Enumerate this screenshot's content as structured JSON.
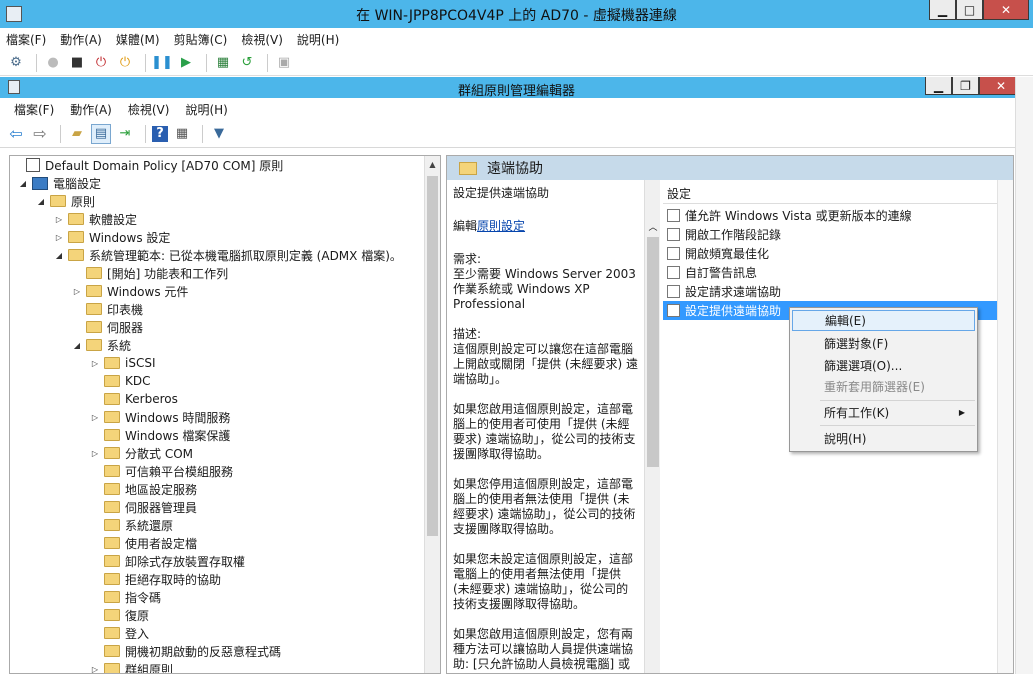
{
  "vm": {
    "title": "在 WIN-JPP8PCO4V4P 上的 AD70 - 虛擬機器連線",
    "menu": [
      "檔案(F)",
      "動作(A)",
      "媒體(M)",
      "剪貼簿(C)",
      "檢視(V)",
      "說明(H)"
    ]
  },
  "gp": {
    "title": "群組原則管理編輯器",
    "menu": [
      "檔案(F)",
      "動作(A)",
      "檢視(V)",
      "說明(H)"
    ],
    "tree": [
      {
        "label": "Default Domain Policy [AD70               COM] 原則"
      },
      {
        "label": "電腦設定"
      },
      {
        "label": "原則"
      },
      {
        "label": "軟體設定"
      },
      {
        "label": "Windows 設定"
      },
      {
        "label": "系統管理範本: 已從本機電腦抓取原則定義 (ADMX 檔案)。"
      },
      {
        "label": "[開始] 功能表和工作列"
      },
      {
        "label": "Windows 元件"
      },
      {
        "label": "印表機"
      },
      {
        "label": "伺服器"
      },
      {
        "label": "系統"
      },
      {
        "label": "iSCSI"
      },
      {
        "label": "KDC"
      },
      {
        "label": "Kerberos"
      },
      {
        "label": "Windows 時間服務"
      },
      {
        "label": "Windows 檔案保護"
      },
      {
        "label": "分散式 COM"
      },
      {
        "label": "可信賴平台模組服務"
      },
      {
        "label": "地區設定服務"
      },
      {
        "label": "伺服器管理員"
      },
      {
        "label": "系統還原"
      },
      {
        "label": "使用者設定檔"
      },
      {
        "label": "卸除式存放裝置存取權"
      },
      {
        "label": "拒絕存取時的協助"
      },
      {
        "label": "指令碼"
      },
      {
        "label": "復原"
      },
      {
        "label": "登入"
      },
      {
        "label": "開機初期啟動的反惡意程式碼"
      },
      {
        "label": "群組原則"
      }
    ],
    "right": {
      "header": "遠端協助",
      "desc_title": "設定提供遠端協助",
      "edit_prefix": "編輯",
      "edit_link": "原則設定",
      "req": "需求:\n至少需要 Windows Server 2003 作業系統或 Windows XP Professional",
      "d1": "描述:\n這個原則設定可以讓您在這部電腦上開啟或關閉「提供 (未經要求) 遠端協助」。",
      "d2": "如果您啟用這個原則設定，這部電腦上的使用者可使用「提供 (未經要求) 遠端協助」，從公司的技術支援團隊取得協助。",
      "d3": "如果您停用這個原則設定，這部電腦上的使用者無法使用「提供 (未經要求) 遠端協助」，從公司的技術支援團隊取得協助。",
      "d4": "如果您未設定這個原則設定，這部電腦上的使用者無法使用「提供 (未經要求) 遠端協助」，從公司的技術支援團隊取得協助。",
      "d5": "如果您啟用這個原則設定，您有兩種方法可以讓協助人員提供遠端協助: [只允許協助人員檢視電腦] 或",
      "col_header": "設定",
      "items": [
        "僅允許 Windows Vista 或更新版本的連線",
        "開啟工作階段記錄",
        "開啟頻寬最佳化",
        "自訂警告訊息",
        "設定請求遠端協助",
        "設定提供遠端協助"
      ]
    },
    "context_menu": [
      "編輯(E)",
      "篩選對象(F)",
      "篩選選項(O)...",
      "重新套用篩選器(E)",
      "所有工作(K)",
      "說明(H)"
    ]
  },
  "colors": {
    "titlebar": "#4cb6ea",
    "selection": "#3399ff",
    "pane_header": "#c6daea"
  }
}
